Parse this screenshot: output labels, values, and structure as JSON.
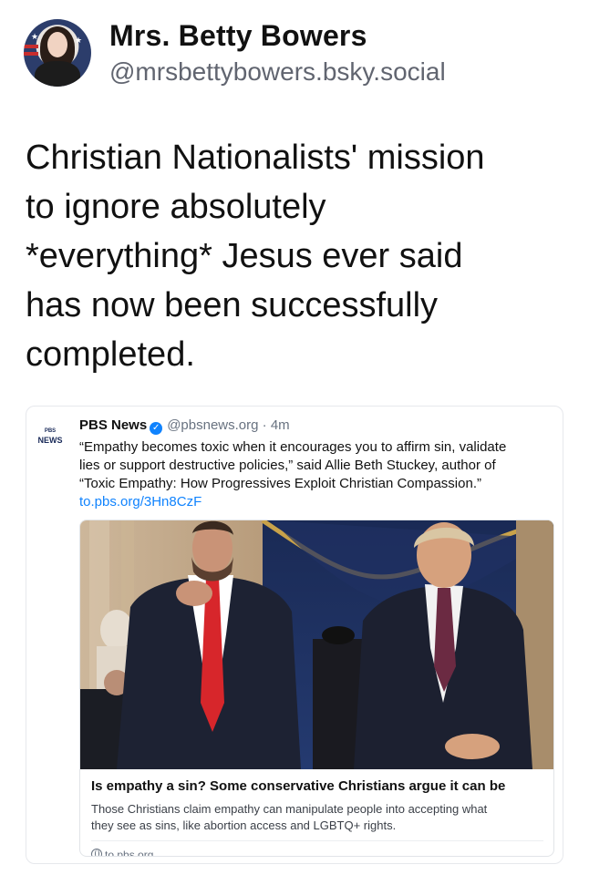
{
  "post": {
    "display_name": "Mrs. Betty Bowers",
    "handle": "@mrsbettybowers.bsky.social",
    "text_lines": [
      "Christian Nationalists' mission",
      "to ignore absolutely",
      "*everything* Jesus ever said",
      "has now been successfully",
      "completed."
    ]
  },
  "quoted": {
    "logo_top": "PBS",
    "logo_bottom": "NEWS",
    "author": "PBS News",
    "handle": "@pbsnews.org",
    "separator": "·",
    "time": "4m",
    "text_lines": [
      "“Empathy becomes toxic when it encourages you to affirm sin, validate",
      "lies or support destructive policies,” said Allie Beth Stuckey, author of",
      "“Toxic Empathy: How Progressives Exploit Christian Compassion.”"
    ],
    "link_text": "to.pbs.org/3Hn8CzF",
    "card": {
      "title": "Is empathy a sin? Some conservative Christians argue it can be",
      "description_lines": [
        "Those Christians claim empathy can manipulate people into accepting what",
        "they see as sins, like abortion access and LGBTQ+ rights."
      ],
      "domain": "to.pbs.org"
    }
  },
  "colors": {
    "link_blue": "#1083fe",
    "verified_blue": "#1083fe",
    "muted_text": "#616570",
    "tie_red": "#d7262b",
    "suit_navy": "#1d2233"
  },
  "icons": [
    "verified-badge-icon",
    "globe-icon"
  ]
}
